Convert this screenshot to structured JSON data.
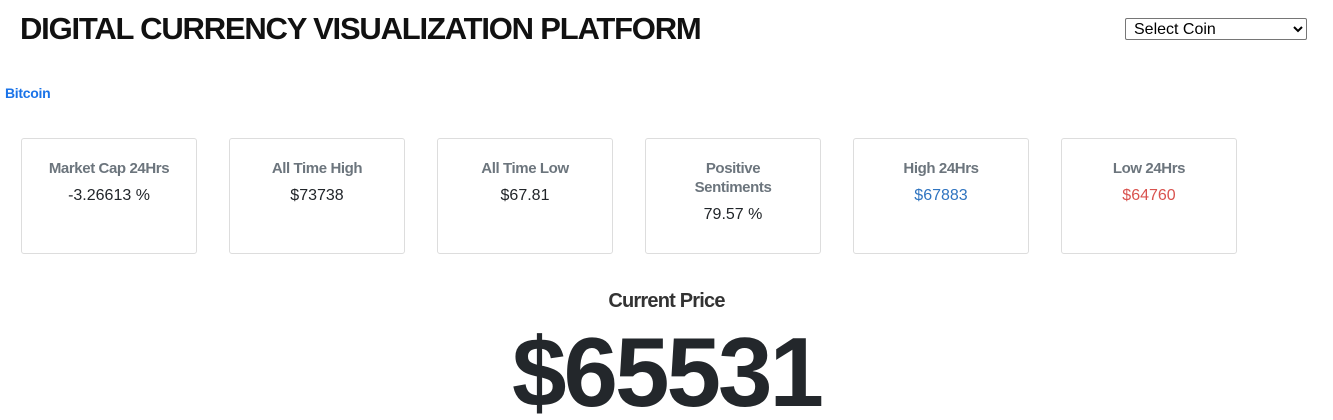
{
  "header": {
    "title": "DIGITAL CURRENCY VISUALIZATION PLATFORM",
    "coin_select": {
      "selected": "Select Coin",
      "options": [
        "Select Coin"
      ]
    }
  },
  "coin": {
    "name": "Bitcoin"
  },
  "stats": [
    {
      "label": "Market Cap 24Hrs",
      "value": "-3.26613 %",
      "color": "#212529"
    },
    {
      "label": "All Time High",
      "value": "$73738",
      "color": "#212529"
    },
    {
      "label": "All Time Low",
      "value": "$67.81",
      "color": "#212529"
    },
    {
      "label": "Positive Sentiments",
      "value": "79.57 %",
      "color": "#212529"
    },
    {
      "label": "High 24Hrs",
      "value": "$67883",
      "color": "#2f74c0"
    },
    {
      "label": "Low 24Hrs",
      "value": "$64760",
      "color": "#d9534f"
    }
  ],
  "price": {
    "label": "Current Price",
    "value": "$65531"
  }
}
